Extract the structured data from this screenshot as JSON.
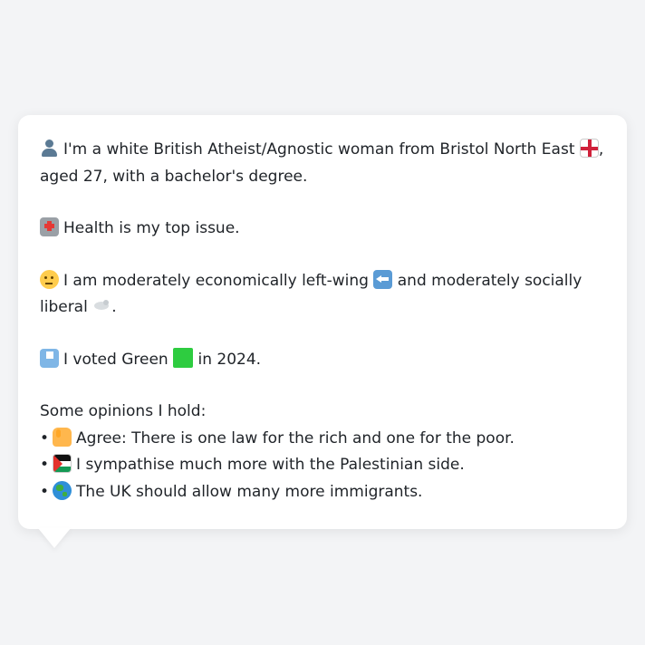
{
  "profile": {
    "intro_text": "I'm a white British Atheist/Agnostic woman from Bristol North East",
    "intro_suffix": ",",
    "intro_line2": "aged 27, with a bachelor's degree.",
    "health_text": "Health is my top issue.",
    "econ_text_1": "I am moderately economically left-wing",
    "econ_text_2": "and moderately socially liberal",
    "econ_suffix": ".",
    "vote_text_1": "I voted Green",
    "vote_text_2": "in 2024.",
    "opinions_heading": "Some opinions I hold:",
    "opinions": [
      {
        "bullet": "•",
        "icon": "thumbs-up-icon",
        "text": "Agree: There is one law for the rich and one for the poor."
      },
      {
        "bullet": "•",
        "icon": "palestine-flag-icon",
        "text": "I sympathise much more with the Palestinian side."
      },
      {
        "bullet": "•",
        "icon": "globe-icon",
        "text": "The UK should allow many more immigrants."
      }
    ]
  },
  "icons": {
    "person": "bust-silhouette-icon",
    "england_flag": "england-flag-icon",
    "hospital": "hospital-icon",
    "thinking": "thinking-face-icon",
    "left_arrow": "left-arrow-icon",
    "dove": "dove-icon",
    "ballot": "ballot-box-icon",
    "green_square": "green-square-icon"
  },
  "colors": {
    "background": "#f3f4f6",
    "card": "#ffffff",
    "text": "#1f2328"
  }
}
